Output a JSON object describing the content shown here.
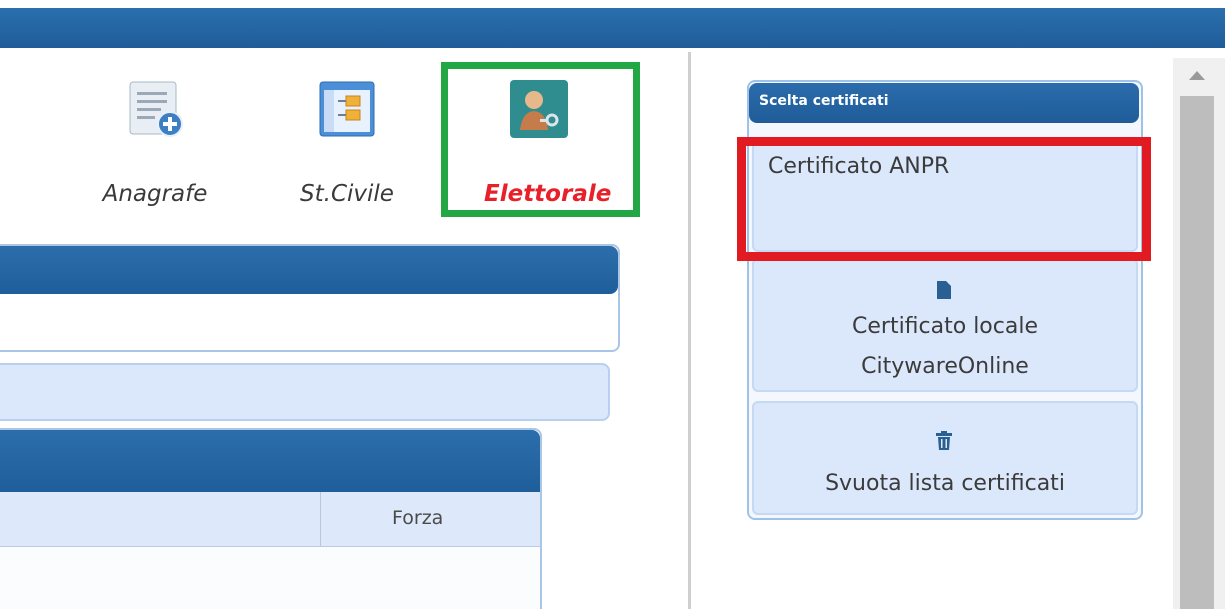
{
  "modules": [
    {
      "label": "Anagrafe",
      "icon": "anagrafe-add-icon"
    },
    {
      "label": "St.Civile",
      "icon": "stato-civile-window-icon"
    },
    {
      "label": "Elettorale",
      "icon": "elettorale-user-key-icon"
    }
  ],
  "table": {
    "column_forza": "Forza"
  },
  "panel": {
    "title": "Scelta certificati",
    "anpr_label": "Certificato ANPR",
    "locale_line1": "Certificato locale",
    "locale_line2": "CitywareOnline",
    "svuota_label": "Svuota lista certificati"
  },
  "colors": {
    "selected_module_label": "#e8202a",
    "green_highlight": "#22a745",
    "red_highlight": "#e21b23",
    "header_blue": "#1f5d99"
  }
}
